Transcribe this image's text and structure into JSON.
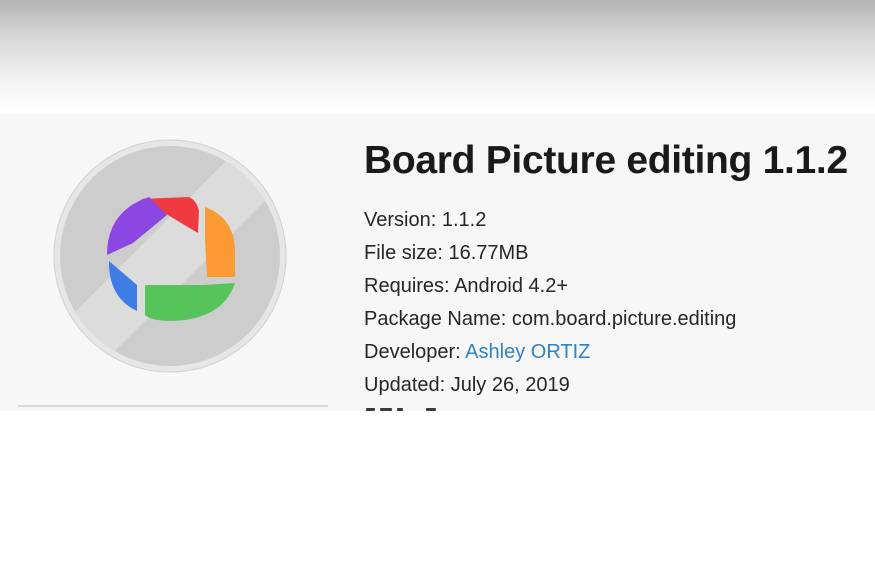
{
  "app": {
    "title": "Board Picture editing 1.1.2",
    "icon": "pinwheel-photo-icon"
  },
  "details": {
    "version": {
      "label": "Version:",
      "value": "1.1.2"
    },
    "file_size": {
      "label": "File size:",
      "value": "16.77MB"
    },
    "requires": {
      "label": "Requires:",
      "value": "Android 4.2+"
    },
    "package_name": {
      "label": "Package Name:",
      "value": "com.board.picture.editing"
    },
    "developer": {
      "label": "Developer:",
      "value": "Ashley ORTIZ"
    },
    "updated": {
      "label": "Updated:",
      "value": "July 26, 2019"
    }
  },
  "colors": {
    "developer_link": "#2f82c6",
    "icon_red": "#ef3b3f",
    "icon_orange": "#fb9a32",
    "icon_green": "#56c45a",
    "icon_blue": "#3e7de6",
    "icon_purple": "#8c46e2"
  }
}
